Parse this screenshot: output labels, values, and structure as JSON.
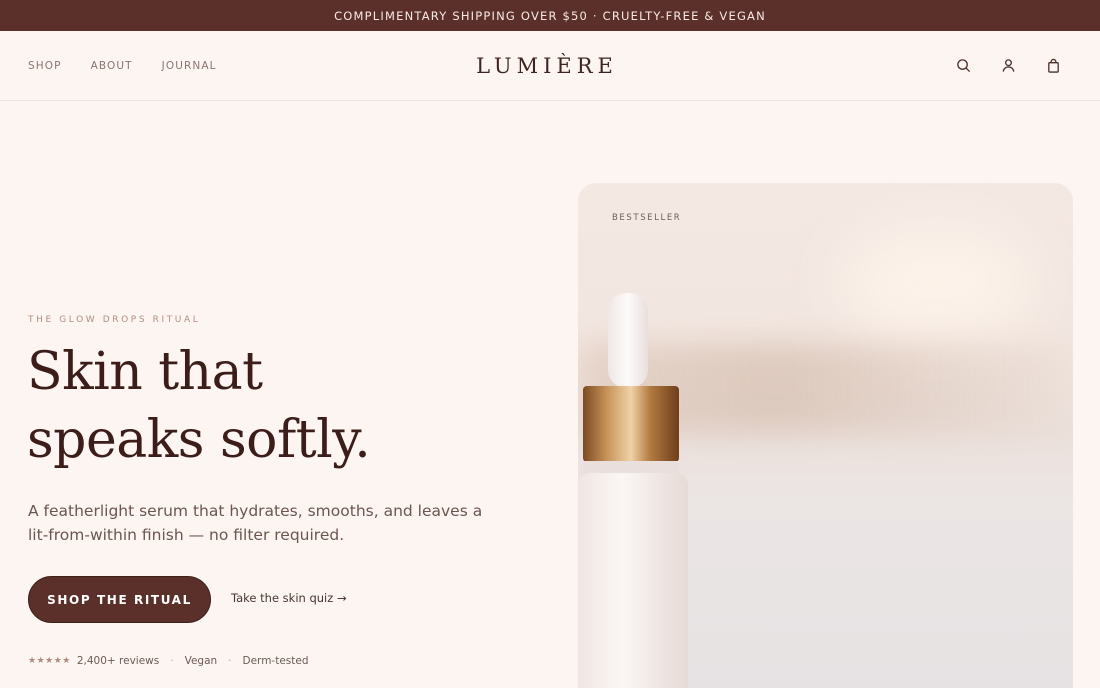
{
  "announcement": "COMPLIMENTARY SHIPPING OVER $50 · CRUELTY-FREE & VEGAN",
  "header": {
    "nav": [
      "SHOP",
      "ABOUT",
      "JOURNAL"
    ],
    "logo": "LUMIÈRE",
    "icons": [
      "search-icon",
      "account-icon",
      "bag-icon"
    ]
  },
  "hero": {
    "eyebrow": "THE GLOW DROPS RITUAL",
    "headline_line1": "Skin that",
    "headline_line2": "speaks softly.",
    "subcopy": "A featherlight serum that hydrates, smooths, and leaves a lit-from-within finish — no filter required.",
    "cta_label": "SHOP THE RITUAL",
    "quiz_link": "Take the skin quiz →",
    "rating_stars": "★★★★★",
    "rating_count": 5,
    "reviews": "2,400+ reviews",
    "separator": "·",
    "tag_vegan": "Vegan",
    "tag_derm": "Derm-tested",
    "image_badge": "BESTSELLER"
  },
  "colors": {
    "brand": "#5c302a",
    "background": "#fcf5f2",
    "heading": "#3c1d1a"
  }
}
